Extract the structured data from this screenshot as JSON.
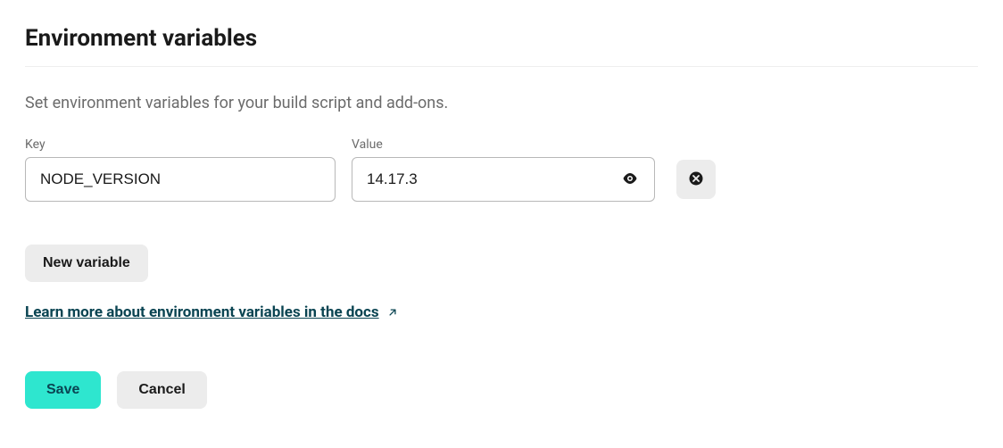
{
  "header": {
    "title": "Environment variables"
  },
  "description": "Set environment variables for your build script and add-ons.",
  "fields": {
    "key_label": "Key",
    "value_label": "Value"
  },
  "variables": [
    {
      "key": "NODE_VERSION",
      "value": "14.17.3"
    }
  ],
  "buttons": {
    "new_variable": "New variable",
    "save": "Save",
    "cancel": "Cancel"
  },
  "link": {
    "learn_more": "Learn more about environment variables in the docs"
  },
  "icons": {
    "eye": "eye-icon",
    "delete": "close-circle-icon",
    "external": "external-link-icon"
  }
}
